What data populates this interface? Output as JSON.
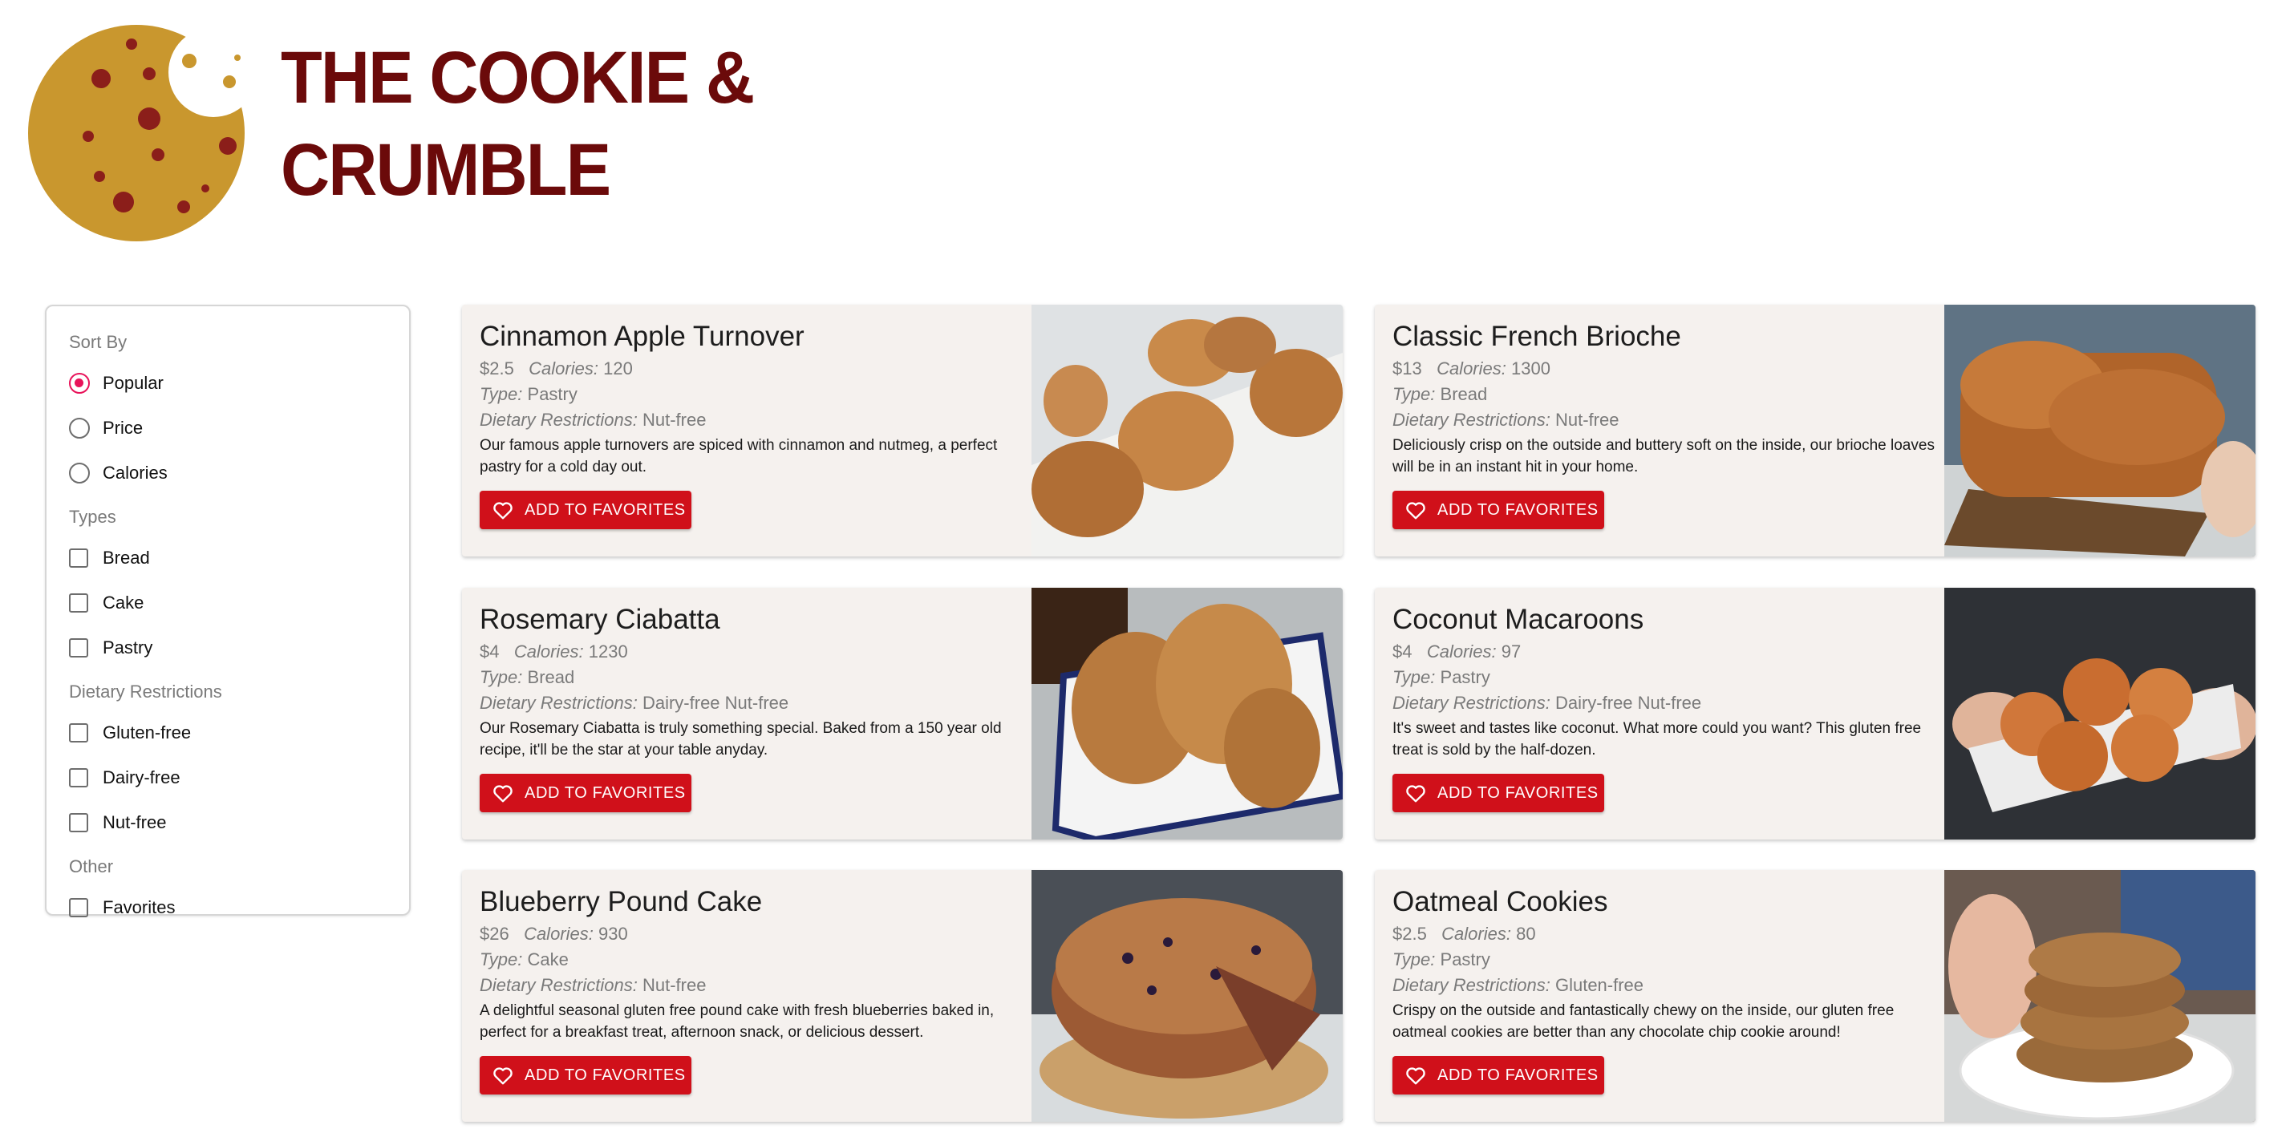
{
  "brand": {
    "line1": "THE COOKIE &",
    "line2": "CRUMBLE",
    "logo_icon": "cookie-logo-icon"
  },
  "sidebar": {
    "sort_title": "Sort By",
    "sort_options": [
      {
        "label": "Popular",
        "checked": true
      },
      {
        "label": "Price",
        "checked": false
      },
      {
        "label": "Calories",
        "checked": false
      }
    ],
    "types_title": "Types",
    "types": [
      "Bread",
      "Cake",
      "Pastry"
    ],
    "dietary_title": "Dietary Restrictions",
    "dietary": [
      "Gluten-free",
      "Dairy-free",
      "Nut-free"
    ],
    "other_title": "Other",
    "other": [
      "Favorites"
    ]
  },
  "labels": {
    "calories": "Calories:",
    "type": "Type:",
    "dietary": "Dietary Restrictions:",
    "favorite_button": "ADD TO FAVORITES"
  },
  "products": [
    {
      "name": "Cinnamon Apple Turnover",
      "price": "$2.5",
      "calories": "120",
      "type": "Pastry",
      "dietary": "Nut-free",
      "description": "Our famous apple turnovers are spiced with cinnamon and nutmeg, a perfect pastry for a cold day out."
    },
    {
      "name": "Classic French Brioche",
      "price": "$13",
      "calories": "1300",
      "type": "Bread",
      "dietary": "Nut-free",
      "description": "Deliciously crisp on the outside and buttery soft on the inside, our brioche loaves will be in an instant hit in your home."
    },
    {
      "name": "Rosemary Ciabatta",
      "price": "$4",
      "calories": "1230",
      "type": "Bread",
      "dietary": "Dairy-free Nut-free",
      "description": "Our Rosemary Ciabatta is truly something special. Baked from a 150 year old recipe, it'll be the star at your table anyday."
    },
    {
      "name": "Coconut Macaroons",
      "price": "$4",
      "calories": "97",
      "type": "Pastry",
      "dietary": "Dairy-free Nut-free",
      "description": "It's sweet and tastes like coconut. What more could you want? This gluten free treat is sold by the half-dozen."
    },
    {
      "name": "Blueberry Pound Cake",
      "price": "$26",
      "calories": "930",
      "type": "Cake",
      "dietary": "Nut-free",
      "description": "A delightful seasonal gluten free pound cake with fresh blueberries baked in, perfect for a breakfast treat, afternoon snack, or delicious dessert."
    },
    {
      "name": "Oatmeal Cookies",
      "price": "$2.5",
      "calories": "80",
      "type": "Pastry",
      "dietary": "Gluten-free",
      "description": "Crispy on the outside and fantastically chewy on the inside, our gluten free oatmeal cookies are better than any chocolate chip cookie around!"
    }
  ],
  "colors": {
    "brand": "#6b0a0a",
    "logo": "#c9972e",
    "accent_radio": "#e8135a",
    "button": "#d0101a",
    "card_bg": "#f5f1ee"
  }
}
